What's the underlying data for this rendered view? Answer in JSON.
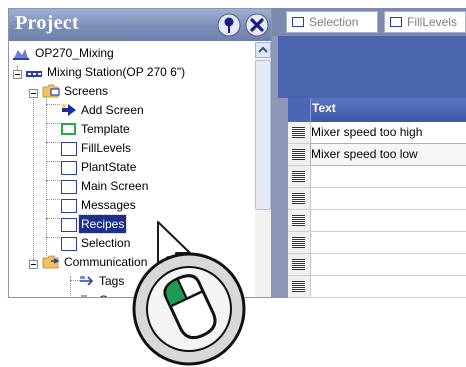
{
  "project": {
    "title": "Project",
    "tree": [
      {
        "label": "OP270_Mixing",
        "icon": "project-icon"
      },
      {
        "label": "Mixing Station(OP 270 6\")",
        "icon": "device-icon"
      },
      {
        "label": "Screens",
        "icon": "folder-icon"
      },
      {
        "label": "Add Screen",
        "icon": "add-screen-icon"
      },
      {
        "label": "Template",
        "icon": "template-icon"
      },
      {
        "label": "FillLevels",
        "icon": "screen-icon"
      },
      {
        "label": "PlantState",
        "icon": "screen-icon"
      },
      {
        "label": "Main Screen",
        "icon": "screen-icon"
      },
      {
        "label": "Messages",
        "icon": "screen-icon"
      },
      {
        "label": "Recipes",
        "icon": "screen-icon",
        "selected": true
      },
      {
        "label": "Selection",
        "icon": "screen-icon"
      },
      {
        "label": "Communication",
        "icon": "folder-icon"
      },
      {
        "label": "Tags",
        "icon": "tags-icon"
      },
      {
        "label": "C",
        "icon": "connections-icon"
      }
    ]
  },
  "editor": {
    "tabs": [
      {
        "label": "Selection"
      },
      {
        "label": "FillLevels"
      }
    ],
    "table": {
      "column_header": "Text",
      "rows": [
        "Mixer speed too high",
        "Mixer speed too low"
      ]
    }
  },
  "colors": {
    "panel_header": "#7d8fb8",
    "selection": "#1c2f8e",
    "editor_background": "#8c98b6",
    "editor_band": "#4a63ad",
    "close_button": "#1a1a8c"
  }
}
